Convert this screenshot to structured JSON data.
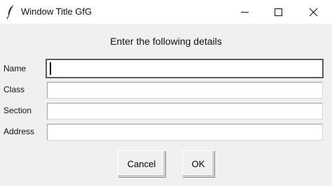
{
  "window": {
    "title": "Window Title GfG",
    "icon": "feather-icon",
    "controls": [
      "minimize-icon",
      "maximize-icon",
      "close-icon"
    ]
  },
  "form": {
    "heading": "Enter the following details",
    "fields": [
      {
        "label": "Name",
        "value": ""
      },
      {
        "label": "Class",
        "value": ""
      },
      {
        "label": "Section",
        "value": ""
      },
      {
        "label": "Address",
        "value": ""
      }
    ]
  },
  "buttons": {
    "cancel": "Cancel",
    "ok": "OK"
  },
  "colors": {
    "window_bg": "#f0f0f0",
    "titlebar_bg": "#ffffff",
    "focus_border": "#5c5c5c"
  }
}
